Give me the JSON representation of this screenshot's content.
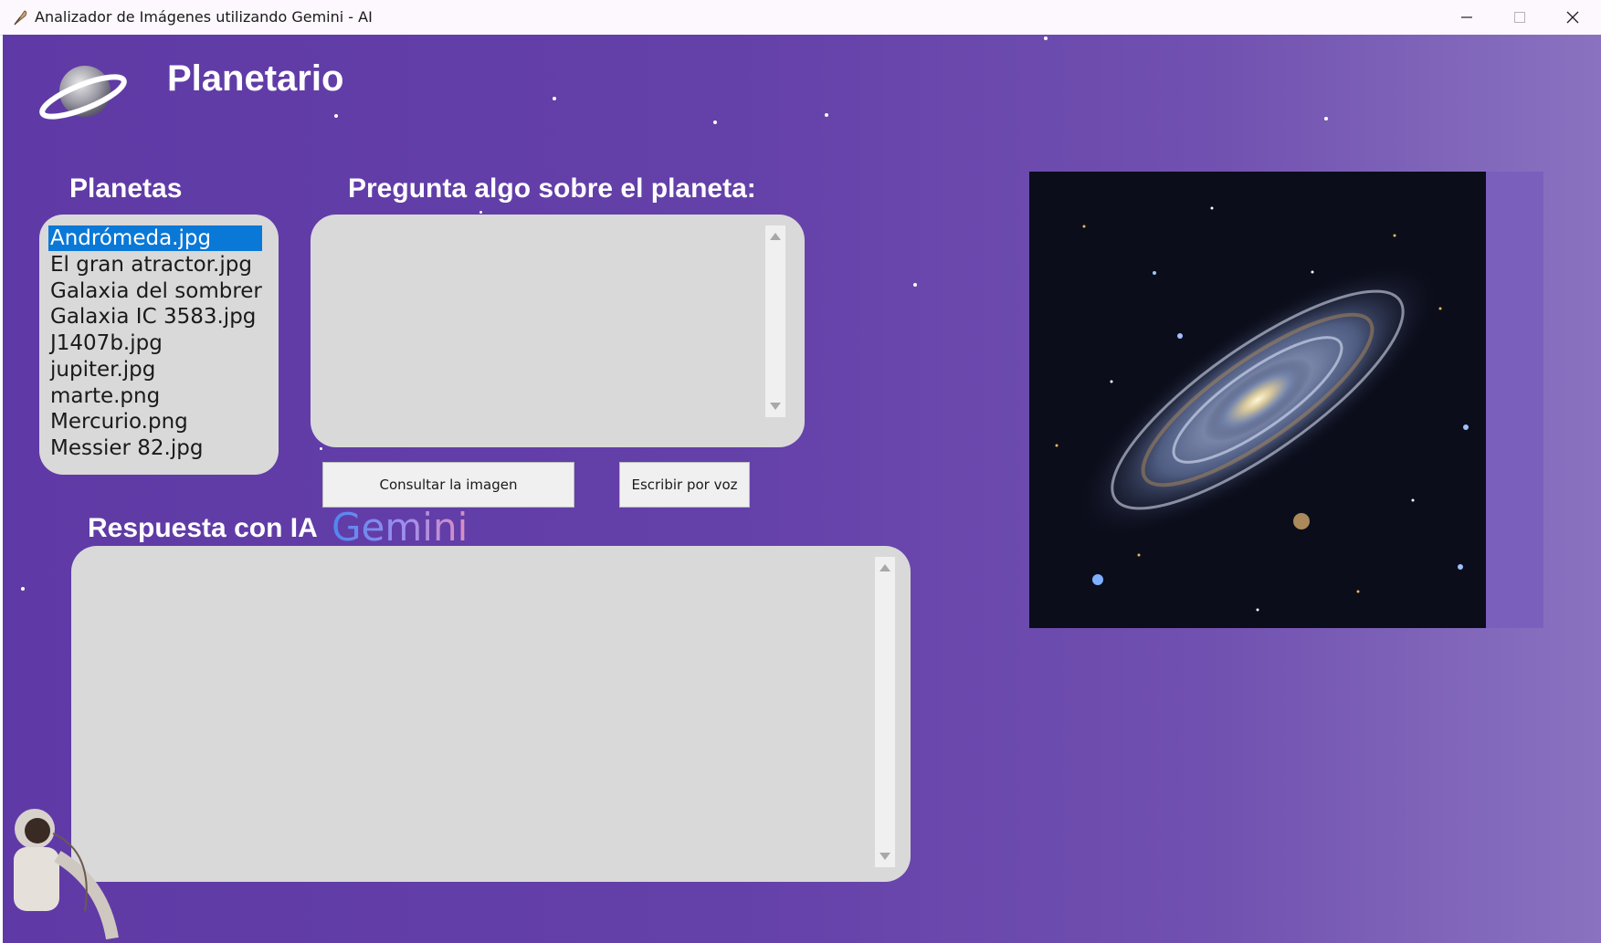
{
  "window": {
    "title": "Analizador de Imágenes utilizando Gemini - AI"
  },
  "header": {
    "app_title": "Planetario"
  },
  "planets": {
    "label": "Planetas",
    "items": [
      "Andrómeda.jpg",
      "El gran atractor.jpg",
      "Galaxia del sombrero.",
      "Galaxia IC 3583.jpg",
      "J1407b.jpg",
      "jupiter.jpg",
      "marte.png",
      "Mercurio.png",
      "Messier 82.jpg"
    ],
    "selected": "Andrómeda.jpg"
  },
  "question": {
    "label": "Pregunta algo sobre el planeta:",
    "value": ""
  },
  "buttons": {
    "consult": "Consultar la imagen",
    "voice": "Escribir por voz"
  },
  "answer": {
    "label": "Respuesta con IA",
    "brand": "Gemini",
    "value": ""
  },
  "colors": {
    "background": "#6440a9",
    "textbox": "#d9d9d9",
    "selection": "#0a78d7"
  }
}
